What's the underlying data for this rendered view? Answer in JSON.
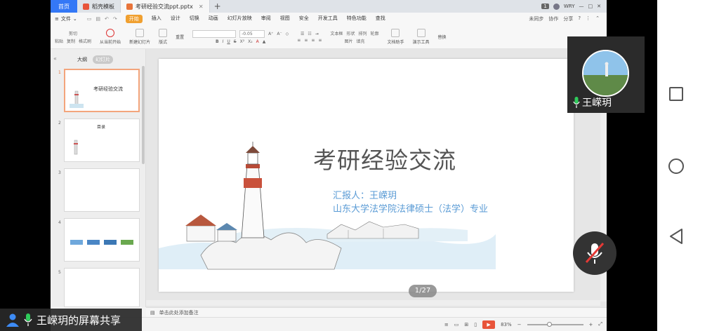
{
  "app": {
    "tabs": {
      "home": "首页",
      "template": "稻壳模板",
      "document": "考研经验交流ppt.pptx"
    },
    "account": {
      "badge": "1",
      "user": "WRY"
    },
    "menu": {
      "file": "文件",
      "items": [
        "开始",
        "插入",
        "设计",
        "切换",
        "动画",
        "幻灯片放映",
        "审阅",
        "视图",
        "安全",
        "开发工具",
        "特色功能",
        "查找"
      ],
      "right": [
        "未同步",
        "协作",
        "分享"
      ]
    },
    "ribbon": {
      "cut": "剪切",
      "copy": "复制",
      "paste": "粘贴",
      "format_painter": "格式刷",
      "play_from_current": "从当前开始",
      "new_slide": "新建幻灯片",
      "layout": "版式",
      "reset": "重置",
      "font_size": "-0.05",
      "text_box": "文本框",
      "shapes": "形状",
      "arrange": "排列",
      "outline": "轮廓",
      "picture": "图片",
      "fill": "填充",
      "doc_helper": "文档助手",
      "presentation_tools": "演示工具",
      "replace": "替换"
    },
    "left_panel": {
      "tab_outline": "大纲",
      "tab_slides": "幻灯片",
      "thumbs": [
        {
          "num": "1",
          "title": "考研经验交流"
        },
        {
          "num": "2",
          "title": "目录"
        },
        {
          "num": "3",
          "title": ""
        },
        {
          "num": "4",
          "title": ""
        },
        {
          "num": "5",
          "title": ""
        }
      ]
    },
    "slide": {
      "title": "考研经验交流",
      "reporter": "汇报人：王嵘玥",
      "affiliation": "山东大学法学院法律硕士（法学）专业",
      "page_indicator": "1/27"
    },
    "notes_placeholder": "单击此处添加备注",
    "status": {
      "zoom": "83%"
    }
  },
  "meeting": {
    "remote_name": "王嵘玥",
    "share_label": "王嵘玥的屏幕共享"
  },
  "colors": {
    "accent_blue": "#3478f6",
    "start_tab": "#f0a030",
    "slide_subtitle": "#5a9bd5",
    "mic_green": "#2fcb5b",
    "play_red": "#e8543a"
  }
}
